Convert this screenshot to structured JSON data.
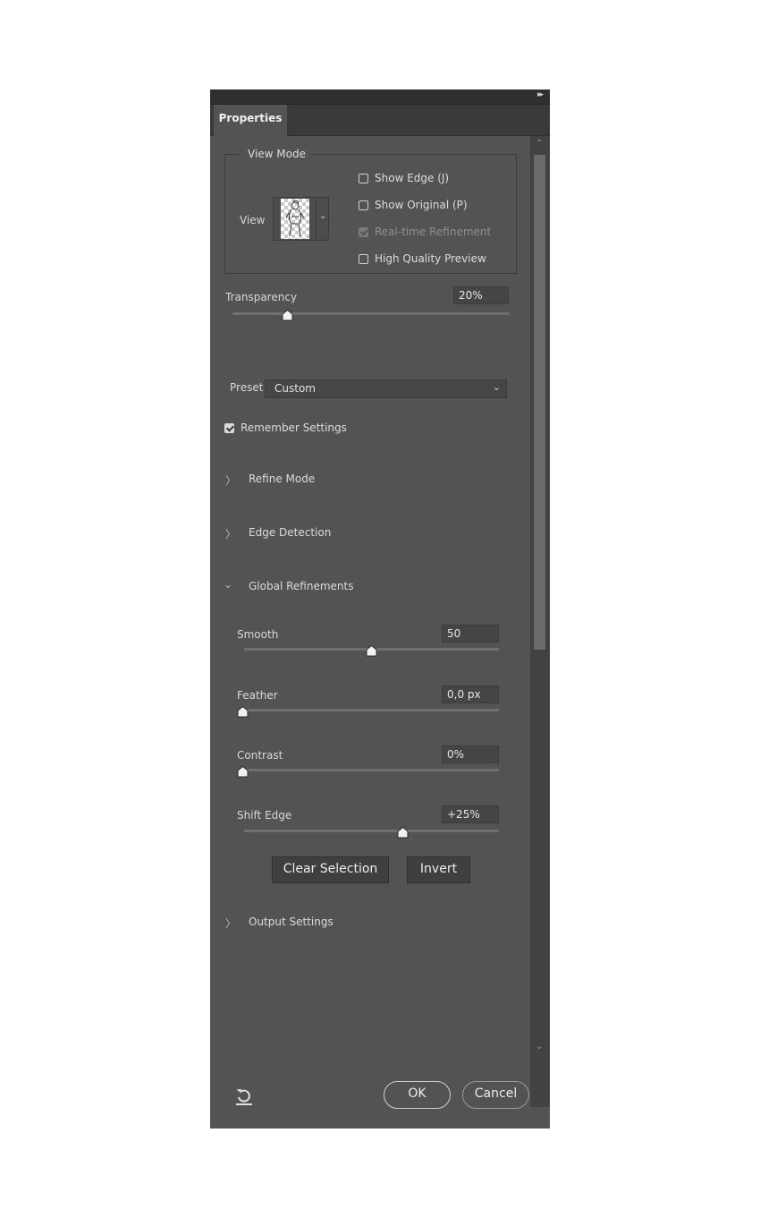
{
  "panel": {
    "tab_label": "Properties",
    "collapse_icon": "double-chevron-right-icon"
  },
  "view_mode": {
    "legend": "View Mode",
    "view_label": "View",
    "checkboxes": [
      {
        "label": "Show Edge (J)",
        "checked": false,
        "enabled": true
      },
      {
        "label": "Show Original (P)",
        "checked": false,
        "enabled": true
      },
      {
        "label": "Real-time Refinement",
        "checked": true,
        "enabled": false
      },
      {
        "label": "High Quality Preview",
        "checked": false,
        "enabled": true
      }
    ]
  },
  "transparency": {
    "label": "Transparency",
    "value": "20%",
    "level": 0.2
  },
  "preset": {
    "label": "Preset",
    "value": "Custom"
  },
  "remember_settings": {
    "label": "Remember Settings",
    "checked": true
  },
  "sections": {
    "refine_mode": "Refine Mode",
    "edge_detection": "Edge Detection",
    "global_refinements": "Global Refinements",
    "output_settings": "Output Settings"
  },
  "sliders": [
    {
      "label": "Smooth",
      "value": "50",
      "level": 0.5
    },
    {
      "label": "Feather",
      "value": "0,0 px",
      "level": 0.0
    },
    {
      "label": "Contrast",
      "value": "0%",
      "level": 0.0
    },
    {
      "label": "Shift Edge",
      "value": "+25%",
      "level": 0.625
    }
  ],
  "buttons": {
    "clear_selection": "Clear Selection",
    "invert": "Invert",
    "ok": "OK",
    "cancel": "Cancel"
  },
  "colors": {
    "panel_bg": "#535353",
    "tab_bar_bg": "#3a3a3a",
    "text": "#dcdcdc"
  }
}
